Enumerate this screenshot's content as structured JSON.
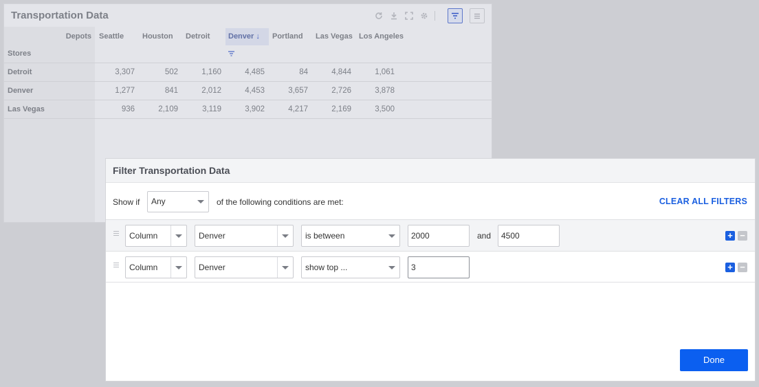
{
  "widget": {
    "title": "Transportation Data",
    "corner_left": "Depots",
    "corner_bottom": "Stores",
    "columns": [
      "Seattle",
      "Houston",
      "Detroit",
      "Denver",
      "Portland",
      "Las Vegas",
      "Los Angeles"
    ],
    "sorted_column": "Denver",
    "rows": [
      {
        "label": "Detroit",
        "values": [
          "3,307",
          "502",
          "1,160",
          "4,485",
          "84",
          "4,844",
          "1,061"
        ]
      },
      {
        "label": "Denver",
        "values": [
          "1,277",
          "841",
          "2,012",
          "4,453",
          "3,657",
          "2,726",
          "3,878"
        ]
      },
      {
        "label": "Las Vegas",
        "values": [
          "936",
          "2,109",
          "3,119",
          "3,902",
          "4,217",
          "2,169",
          "3,500"
        ]
      }
    ],
    "toolbar_icons": [
      "refresh-icon",
      "download-icon",
      "expand-icon",
      "settings-icon",
      "filter-icon",
      "menu-icon"
    ]
  },
  "filter": {
    "title": "Filter Transportation Data",
    "show_if": "Show if",
    "match_mode": "Any",
    "conditions_suffix": "of the following conditions are met:",
    "clear_all": "CLEAR ALL FILTERS",
    "conditions": [
      {
        "scope": "Column",
        "field": "Denver",
        "operator": "is between",
        "value1": "2000",
        "joiner": "and",
        "value2": "4500"
      },
      {
        "scope": "Column",
        "field": "Denver",
        "operator": "show top ...",
        "value1": "3"
      }
    ],
    "add_symbol": "+",
    "remove_symbol": "−",
    "done": "Done"
  },
  "colors": {
    "accent": "#1a5fe0",
    "done_button": "#0b5ff0",
    "backdrop": "#cdced3"
  }
}
